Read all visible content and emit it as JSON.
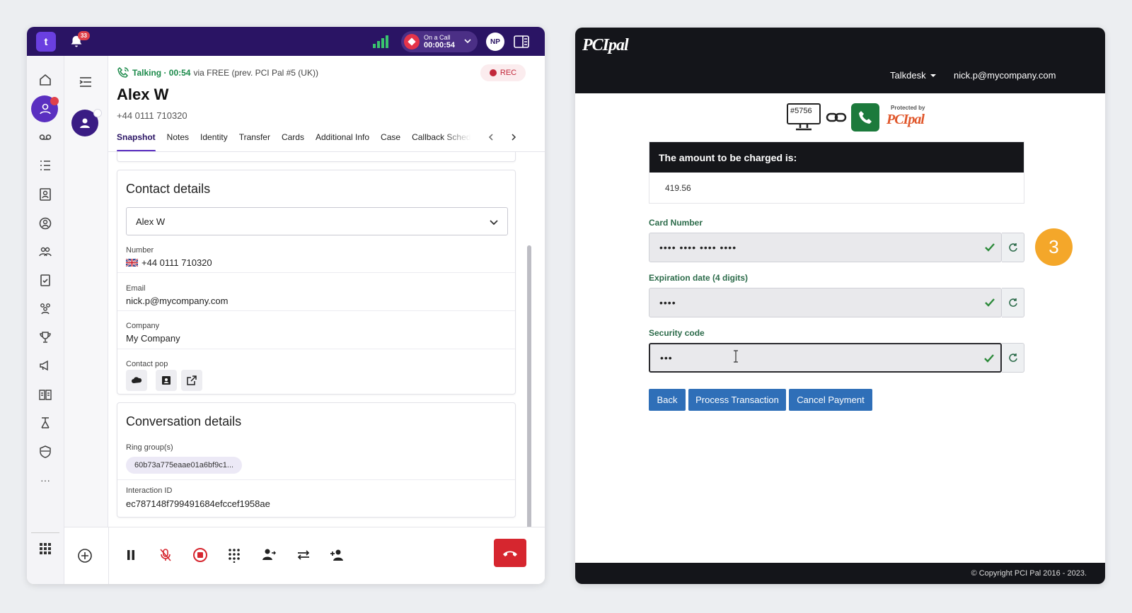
{
  "talkdesk": {
    "logo": "t",
    "notifications_count": "33",
    "call_status": {
      "label": "On a Call",
      "timer": "00:00:54"
    },
    "user_initials": "NP",
    "talking": {
      "status": "Talking · 00:54",
      "via": "via FREE (prev. PCI Pal #5 (UK))"
    },
    "rec_label": "REC",
    "contact": {
      "name": "Alex W",
      "phone": "+44 0111 710320"
    },
    "tabs": [
      "Snapshot",
      "Notes",
      "Identity",
      "Transfer",
      "Cards",
      "Additional Info",
      "Case",
      "Callback Schedu"
    ],
    "contact_details": {
      "title": "Contact details",
      "selected_contact": "Alex W",
      "number_label": "Number",
      "number_value": "+44 0111 710320",
      "email_label": "Email",
      "email_value": "nick.p@mycompany.com",
      "company_label": "Company",
      "company_value": "My Company",
      "contact_pop_label": "Contact pop"
    },
    "conversation_details": {
      "title": "Conversation details",
      "ring_groups_label": "Ring group(s)",
      "ring_group_value": "60b73a775eaae01a6bf9c1...",
      "interaction_id_label": "Interaction ID",
      "interaction_id_value": "ec787148f799491684efccef1958ae"
    },
    "rail_more": "···"
  },
  "pcipal": {
    "logo": "PCIpal",
    "nav": {
      "org": "Talkdesk",
      "user": "nick.p@mycompany.com"
    },
    "session_id": "#5756",
    "protected_by": "Protected by",
    "protected_logo": "PCIpal",
    "amount": {
      "label": "The amount to be charged is:",
      "value": "419.56"
    },
    "card_number": {
      "label": "Card Number",
      "value": "•••• •••• •••• ••••"
    },
    "expiry": {
      "label": "Expiration date (4 digits)",
      "value": "••••"
    },
    "security": {
      "label": "Security code",
      "value": "•••"
    },
    "step_number": "3",
    "buttons": {
      "back": "Back",
      "process": "Process Transaction",
      "cancel": "Cancel Payment"
    },
    "footer": "© Copyright PCI Pal 2016 - 2023."
  },
  "colors": {
    "talkdesk_header": "#2a1464",
    "accent_purple": "#5a2fc0",
    "hangup_red": "#d6262f",
    "pci_dark": "#14151a",
    "pci_button": "#2f6fb8",
    "pci_label_green": "#2c6b4a",
    "step_orange": "#f4a72a"
  },
  "icons": [
    "home-icon",
    "agent-icon",
    "voicemail-icon",
    "list-icon",
    "contacts-icon",
    "live-icon",
    "teams-icon",
    "tasks-icon",
    "groups-icon",
    "trophy-icon",
    "campaign-icon",
    "knowledge-icon",
    "workflow-icon",
    "shield-icon",
    "apps-grid-icon",
    "add-icon",
    "pause-icon",
    "mute-icon",
    "stop-record-icon",
    "keypad-icon",
    "consult-icon",
    "transfer-icon",
    "add-participant-icon",
    "hangup-icon"
  ]
}
